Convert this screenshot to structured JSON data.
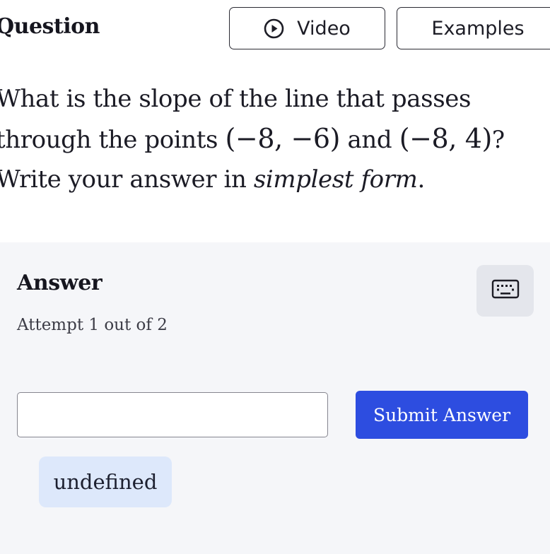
{
  "header": {
    "title": "Question",
    "tabs": [
      {
        "label": "Video",
        "icon": "play-circle-icon"
      },
      {
        "label": "Examples"
      }
    ]
  },
  "question": {
    "line1": "What is the slope of the line that passes",
    "line2_prefix": "through the points ",
    "point1": "(−8, −6)",
    "line2_mid": " and ",
    "point2": "(−8, 4)",
    "line2_suffix": "?",
    "line3_prefix": "Write your answer in ",
    "line3_emphasis": "simplest form",
    "line3_suffix": "."
  },
  "answer": {
    "title": "Answer",
    "attempt": "Attempt 1 out of 2",
    "input_value": "",
    "input_placeholder": "",
    "submit_label": "Submit Answer",
    "keyboard_icon": "keyboard-icon",
    "suggestion": "undefined"
  },
  "colors": {
    "accent": "#2d4de0",
    "answer_bg": "#f5f6f9",
    "chip_bg": "#dde8fb",
    "keyboard_bg": "#e4e6ec"
  }
}
